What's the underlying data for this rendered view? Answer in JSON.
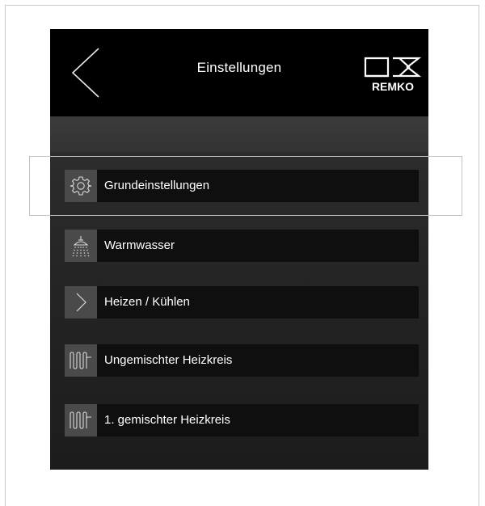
{
  "header": {
    "title": "Einstellungen",
    "back_icon": "chevron-left-icon",
    "logo_text": "REMKO"
  },
  "menu": {
    "items": [
      {
        "label": "Grundeinstellungen",
        "icon": "gear-icon",
        "highlighted": true
      },
      {
        "label": "Warmwasser",
        "icon": "shower-icon"
      },
      {
        "label": "Heizen / Kühlen",
        "icon": "chevron-right-icon"
      },
      {
        "label": "Ungemischter Heizkreis",
        "icon": "heating-circuit-icon"
      },
      {
        "label": "1. gemischter Heizkreis",
        "icon": "heating-circuit-icon"
      }
    ]
  },
  "colors": {
    "topbar": "#000000",
    "panel": "#2e2e2e",
    "item_bg": "#0f0f0f",
    "icon_bg": "#4a4a4a",
    "text": "#ffffff"
  }
}
